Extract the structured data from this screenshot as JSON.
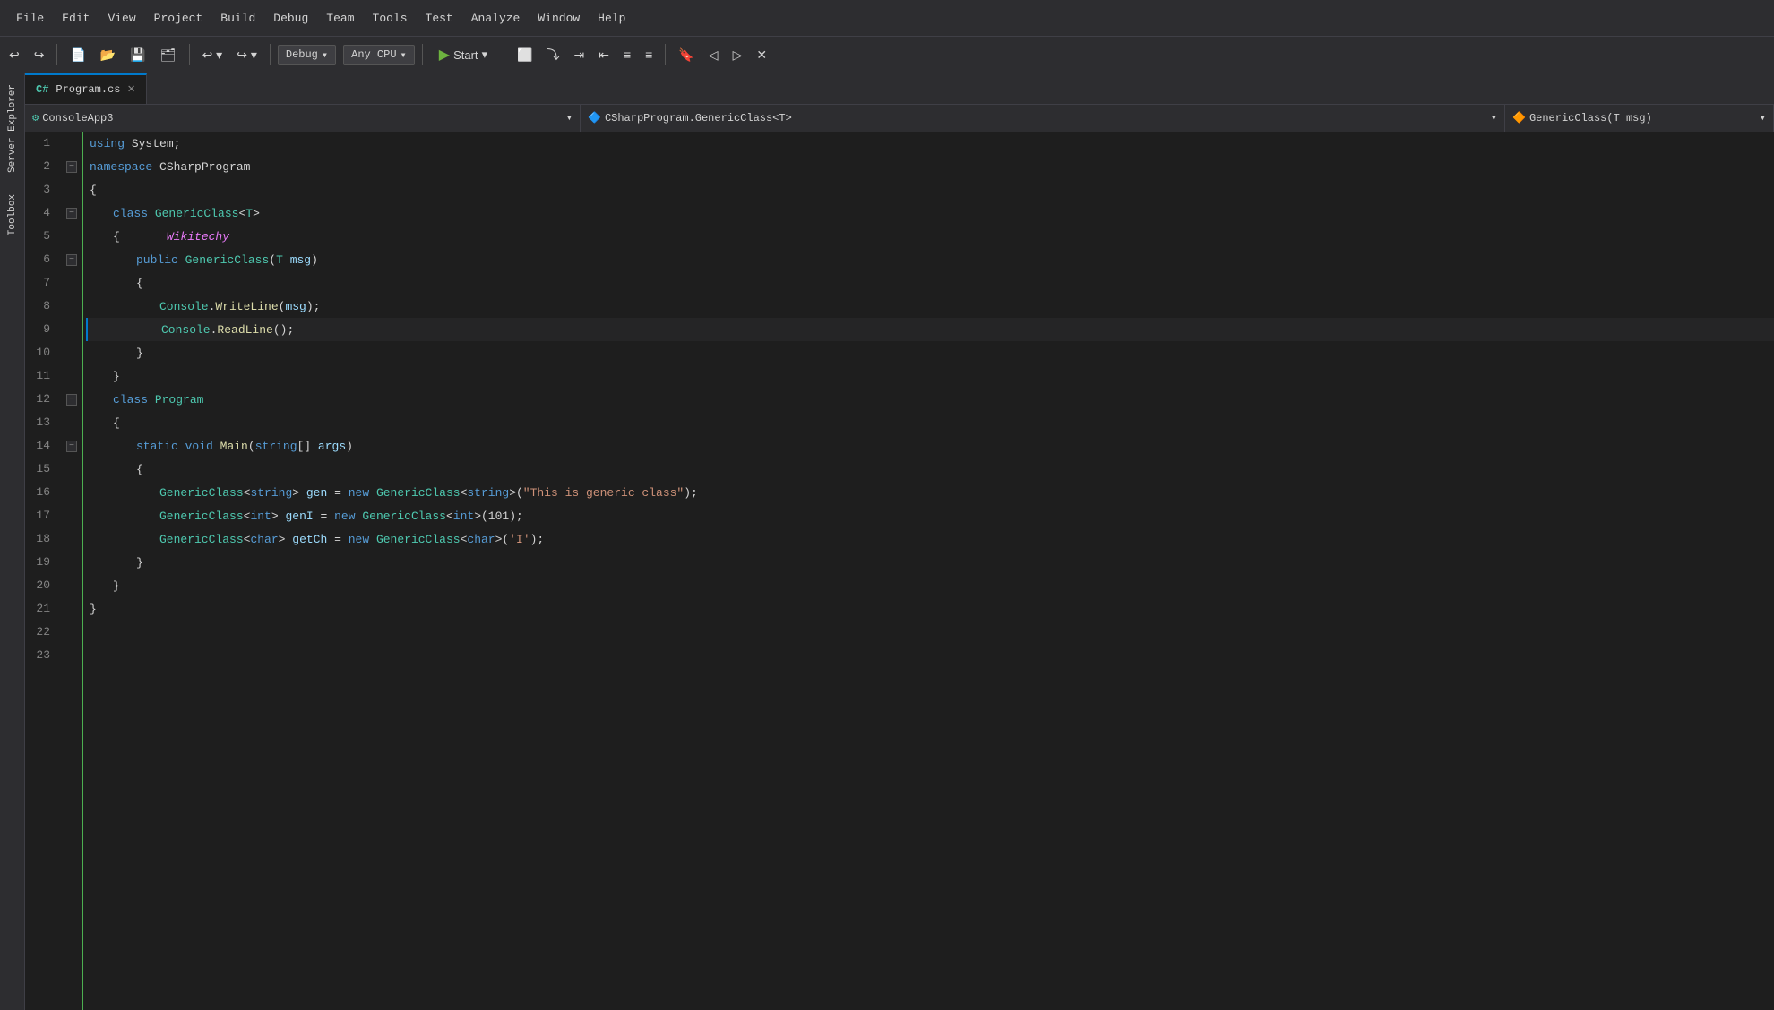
{
  "menubar": {
    "items": [
      "File",
      "Edit",
      "View",
      "Project",
      "Build",
      "Debug",
      "Team",
      "Tools",
      "Test",
      "Analyze",
      "Window",
      "Help"
    ]
  },
  "toolbar": {
    "debug_label": "Debug",
    "cpu_label": "Any CPU",
    "start_label": "Start",
    "chevron": "▾"
  },
  "tabs": {
    "active_tab": "Program.cs",
    "close_icon": "✕"
  },
  "navbar": {
    "project": "ConsoleApp3",
    "class": "CSharpProgram.GenericClass<T>",
    "member": "GenericClass(T msg)"
  },
  "sidebar": {
    "server_explorer": "Server Explorer",
    "toolbox": "Toolbox"
  },
  "code": {
    "lines": [
      {
        "num": 1,
        "content": "using System;"
      },
      {
        "num": 2,
        "content": "namespace CSharpProgram"
      },
      {
        "num": 3,
        "content": "{"
      },
      {
        "num": 4,
        "content": "    class GenericClass<T>"
      },
      {
        "num": 5,
        "content": "    {"
      },
      {
        "num": 6,
        "content": "        public GenericClass(T msg)"
      },
      {
        "num": 7,
        "content": "        {"
      },
      {
        "num": 8,
        "content": "            Console.WriteLine(msg);"
      },
      {
        "num": 9,
        "content": "            Console.ReadLine();"
      },
      {
        "num": 10,
        "content": "        }"
      },
      {
        "num": 11,
        "content": "    }"
      },
      {
        "num": 12,
        "content": "    class Program"
      },
      {
        "num": 13,
        "content": "    {"
      },
      {
        "num": 14,
        "content": "        static void Main(string[] args)"
      },
      {
        "num": 15,
        "content": "        {"
      },
      {
        "num": 16,
        "content": "            GenericClass<string> gen = new GenericClass<string>(\"This is generic class\");"
      },
      {
        "num": 17,
        "content": "            GenericClass<int> genI = new GenericClass<int>(101);"
      },
      {
        "num": 18,
        "content": "            GenericClass<char> getCh = new GenericClass<char>('I');"
      },
      {
        "num": 19,
        "content": "        }"
      },
      {
        "num": 20,
        "content": "    }"
      },
      {
        "num": 21,
        "content": "}"
      },
      {
        "num": 22,
        "content": ""
      },
      {
        "num": 23,
        "content": ""
      }
    ]
  },
  "colors": {
    "background": "#1e1e1e",
    "menu_bg": "#2d2d30",
    "active_line": "#282828",
    "border": "#3f3f46",
    "accent": "#007acc"
  }
}
